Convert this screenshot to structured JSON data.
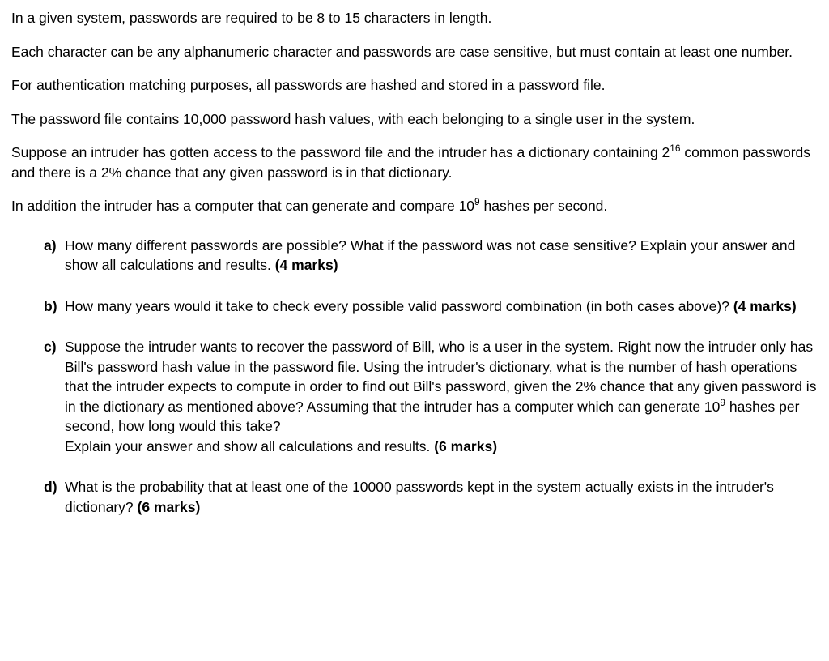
{
  "intro": {
    "p1": "In a given system, passwords are required to be 8 to 15 characters in length.",
    "p2": "Each character can be any alphanumeric character and passwords are case sensitive, but must contain at least one number.",
    "p3": "For authentication matching purposes, all passwords are hashed and stored in a password file.",
    "p4": "The password file contains 10,000 password hash values, with each belonging to a single user in the system.",
    "p5_pre": "Suppose an intruder has gotten access to the password file and the intruder has a dictionary containing 2",
    "p5_exp": "16",
    "p5_post": " common passwords and there is a 2% chance that any given password is in that dictionary.",
    "p6_pre": "In addition the intruder has a computer that can generate and compare 10",
    "p6_exp": "9",
    "p6_post": " hashes per second."
  },
  "questions": {
    "a": {
      "marker": "a)",
      "text": "How many different passwords are possible? What if the password was not case sensitive? Explain your answer and show all calculations and results. ",
      "marks": "(4 marks)"
    },
    "b": {
      "marker": "b)",
      "text": "How many years would it take to check every possible valid password combination (in both cases above)? ",
      "marks": "(4 marks)"
    },
    "c": {
      "marker": "c)",
      "text1": "Suppose the intruder wants to recover the password of Bill, who is a user in the system. Right now the intruder only has Bill's password hash value in the password file. Using the intruder's dictionary, what is the number of hash operations that the intruder expects to compute in order to find out Bill's password, given the 2% chance that any given password is in the dictionary as mentioned above? Assuming that the intruder has a computer which can generate 10",
      "exp": "9",
      "text2": " hashes per second, how long would this take?",
      "text3": "Explain your answer and show all calculations and results. ",
      "marks": "(6 marks)"
    },
    "d": {
      "marker": "d)",
      "text": "What is the probability that at least one of the 10000 passwords kept in the system actually exists in the intruder's dictionary? ",
      "marks": "(6 marks)"
    }
  }
}
